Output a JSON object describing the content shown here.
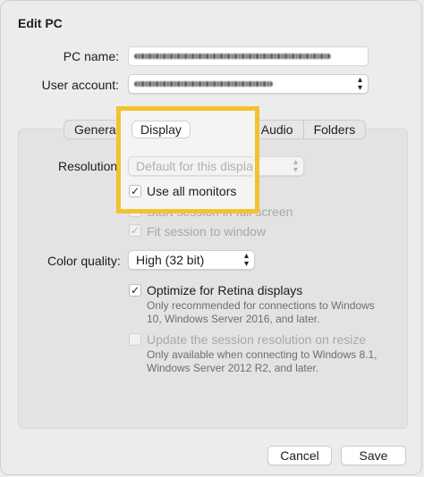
{
  "dialog": {
    "title": "Edit PC"
  },
  "form": {
    "pc_name_label": "PC name:",
    "user_account_label": "User account:"
  },
  "tabs": [
    {
      "label": "General",
      "display": "Genera"
    },
    {
      "label": "Display"
    },
    {
      "label": "Devices & Audio"
    },
    {
      "label": "Folders"
    }
  ],
  "display": {
    "resolution_label": "Resolution",
    "resolution_value": "Default for this display",
    "use_all_monitors_label": "Use all monitors",
    "start_fullscreen_label": "Start session in full screen",
    "fit_session_label": "Fit session to window",
    "color_quality_label": "Color quality:",
    "color_quality_value": "High (32 bit)",
    "retina_label": "Optimize for Retina displays",
    "retina_note_line1": "Only recommended for connections to Windows",
    "retina_note_line2": "10, Windows Server 2016, and later.",
    "update_resolution_label": "Update the session resolution on resize",
    "update_note_line1": "Only available when connecting to Windows 8.1,",
    "update_note_line2": "Windows Server 2012 R2, and later."
  },
  "buttons": {
    "cancel": "Cancel",
    "save": "Save"
  },
  "colors": {
    "highlight": "#f2c230"
  }
}
